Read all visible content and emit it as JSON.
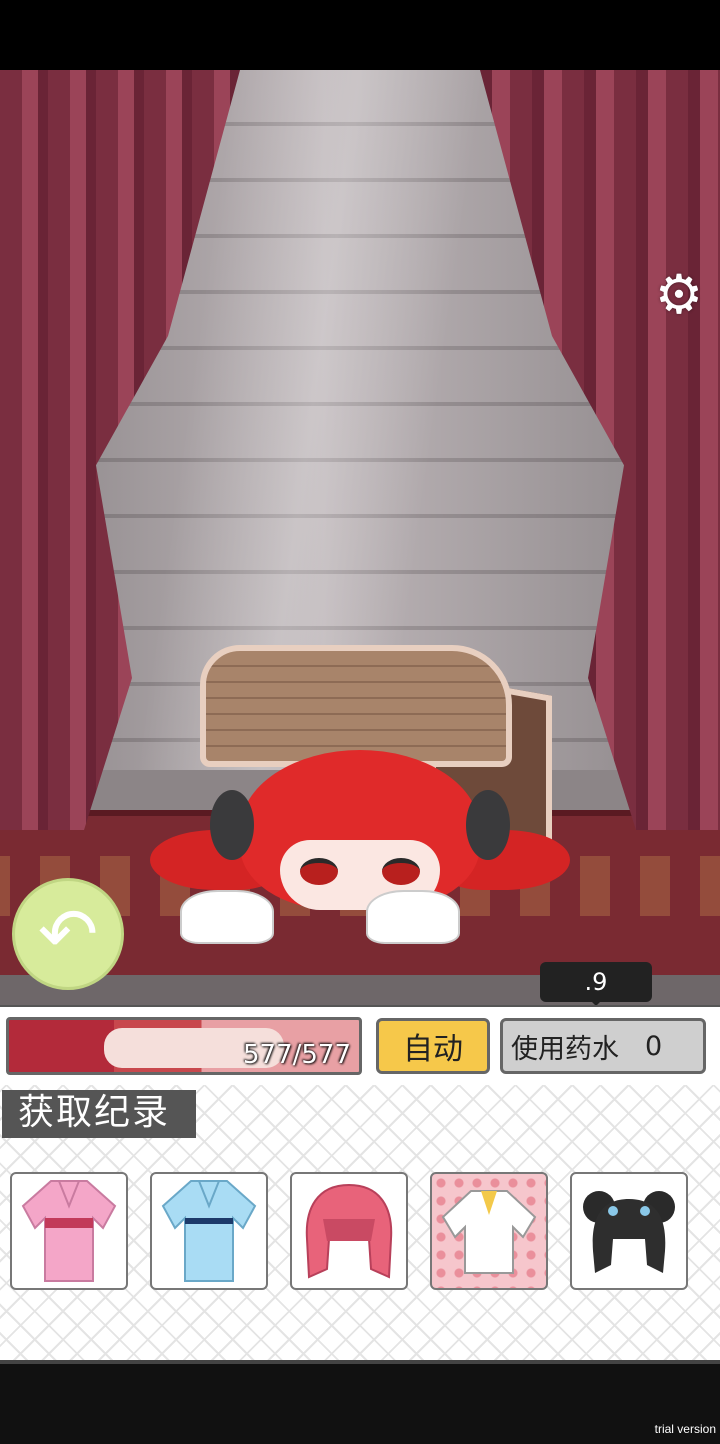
{
  "settings": {
    "icon": "gear-icon"
  },
  "navigation": {
    "back_icon": "back-arrow-icon"
  },
  "tooltip": {
    "text": ".9"
  },
  "status_bar": {
    "hp_text": "577/577",
    "hp_current": 577,
    "hp_max": 577,
    "auto_label": "自动",
    "potion_label": "使用药水",
    "potion_count": "0"
  },
  "inventory": {
    "title": "获取纪录",
    "items": [
      {
        "name": "pink-kimono-icon"
      },
      {
        "name": "blue-kimono-icon"
      },
      {
        "name": "pink-hair-icon"
      },
      {
        "name": "white-shirt-icon"
      },
      {
        "name": "black-horned-hair-icon"
      }
    ]
  },
  "watermark": {
    "text": "trial version"
  },
  "colors": {
    "curtain": "#8a3a4c",
    "auto_button": "#f6c84a",
    "potion_button": "#cfcfcf",
    "back_button": "#d7eb9b"
  }
}
